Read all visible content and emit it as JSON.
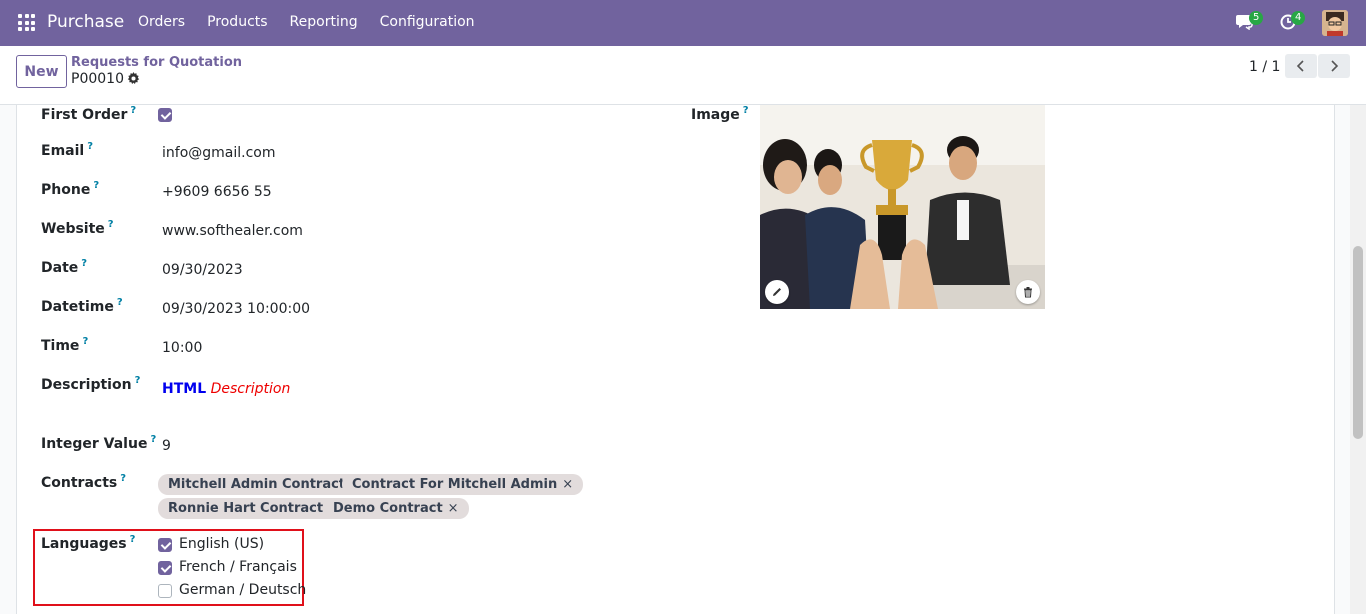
{
  "navbar": {
    "app_name": "Purchase",
    "menu": [
      "Orders",
      "Products",
      "Reporting",
      "Configuration"
    ],
    "messages_count": "5",
    "activities_count": "4",
    "bg_color": "#71639e"
  },
  "control_panel": {
    "new_label": "New",
    "breadcrumb": "Requests for Quotation",
    "record_name": "P00010",
    "pager": "1 / 1"
  },
  "form": {
    "first_order": {
      "label": "First Order",
      "checked": true
    },
    "email": {
      "label": "Email",
      "value": "info@gmail.com"
    },
    "phone": {
      "label": "Phone",
      "value": "+9609 6656 55"
    },
    "website": {
      "label": "Website",
      "value": "www.softhealer.com"
    },
    "date": {
      "label": "Date",
      "value": "09/30/2023"
    },
    "datetime": {
      "label": "Datetime",
      "value": "09/30/2023 10:00:00"
    },
    "time": {
      "label": "Time",
      "value": "10:00"
    },
    "description": {
      "label": "Description",
      "html_part": "HTML",
      "italic_part": "Description"
    },
    "integer_value": {
      "label": "Integer Value",
      "value": "9"
    },
    "contracts": {
      "label": "Contracts",
      "tags": [
        "Mitchell Admin Contract",
        "Contract For Mitchell Admin",
        "Ronnie Hart Contract",
        "Demo Contract"
      ]
    },
    "languages": {
      "label": "Languages",
      "options": [
        {
          "label": "English (US)",
          "checked": true
        },
        {
          "label": "French / Français",
          "checked": true
        },
        {
          "label": "German / Deutsch",
          "checked": false
        }
      ]
    },
    "image": {
      "label": "Image"
    },
    "help_mark": "?",
    "tag_remove": "×"
  }
}
